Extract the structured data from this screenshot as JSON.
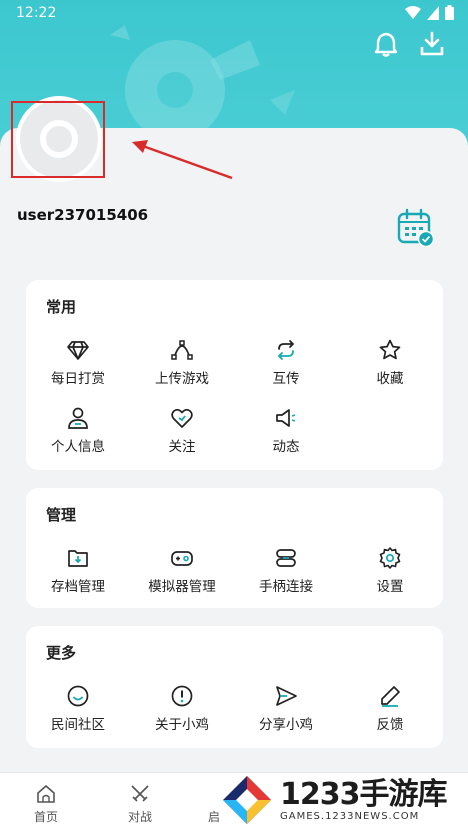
{
  "status_bar": {
    "time": "12:22"
  },
  "header": {
    "bell_icon": "bell-icon",
    "download_icon": "download-icon"
  },
  "profile": {
    "username": "user237015406",
    "calendar_icon": "calendar-check-icon"
  },
  "sections": {
    "common": {
      "title": "常用",
      "items": [
        {
          "label": "每日打赏",
          "icon": "diamond-icon"
        },
        {
          "label": "上传游戏",
          "icon": "upload-curve-icon"
        },
        {
          "label": "互传",
          "icon": "transfer-icon"
        },
        {
          "label": "收藏",
          "icon": "star-icon"
        },
        {
          "label": "个人信息",
          "icon": "user-icon"
        },
        {
          "label": "关注",
          "icon": "heart-icon"
        },
        {
          "label": "动态",
          "icon": "megaphone-icon"
        }
      ]
    },
    "manage": {
      "title": "管理",
      "items": [
        {
          "label": "存档管理",
          "icon": "folder-icon"
        },
        {
          "label": "模拟器管理",
          "icon": "gamepad-icon"
        },
        {
          "label": "手柄连接",
          "icon": "link-icon"
        },
        {
          "label": "设置",
          "icon": "gear-icon"
        }
      ]
    },
    "more": {
      "title": "更多",
      "items": [
        {
          "label": "民间社区",
          "icon": "smile-icon"
        },
        {
          "label": "关于小鸡",
          "icon": "info-icon"
        },
        {
          "label": "分享小鸡",
          "icon": "send-icon"
        },
        {
          "label": "反馈",
          "icon": "pencil-icon"
        }
      ]
    }
  },
  "tabbar": {
    "tabs": [
      {
        "label": "首页",
        "icon": "home-icon"
      },
      {
        "label": "对战",
        "icon": "swords-icon"
      },
      {
        "label": "启",
        "icon": "partial-tab-icon"
      }
    ]
  },
  "watermark": {
    "big": "1233手游库",
    "small": "GAMES.1233NEWS.COM"
  },
  "colors": {
    "header": "#3cc7cf",
    "accent": "#17a9b4",
    "annotation": "#d92b2b"
  }
}
